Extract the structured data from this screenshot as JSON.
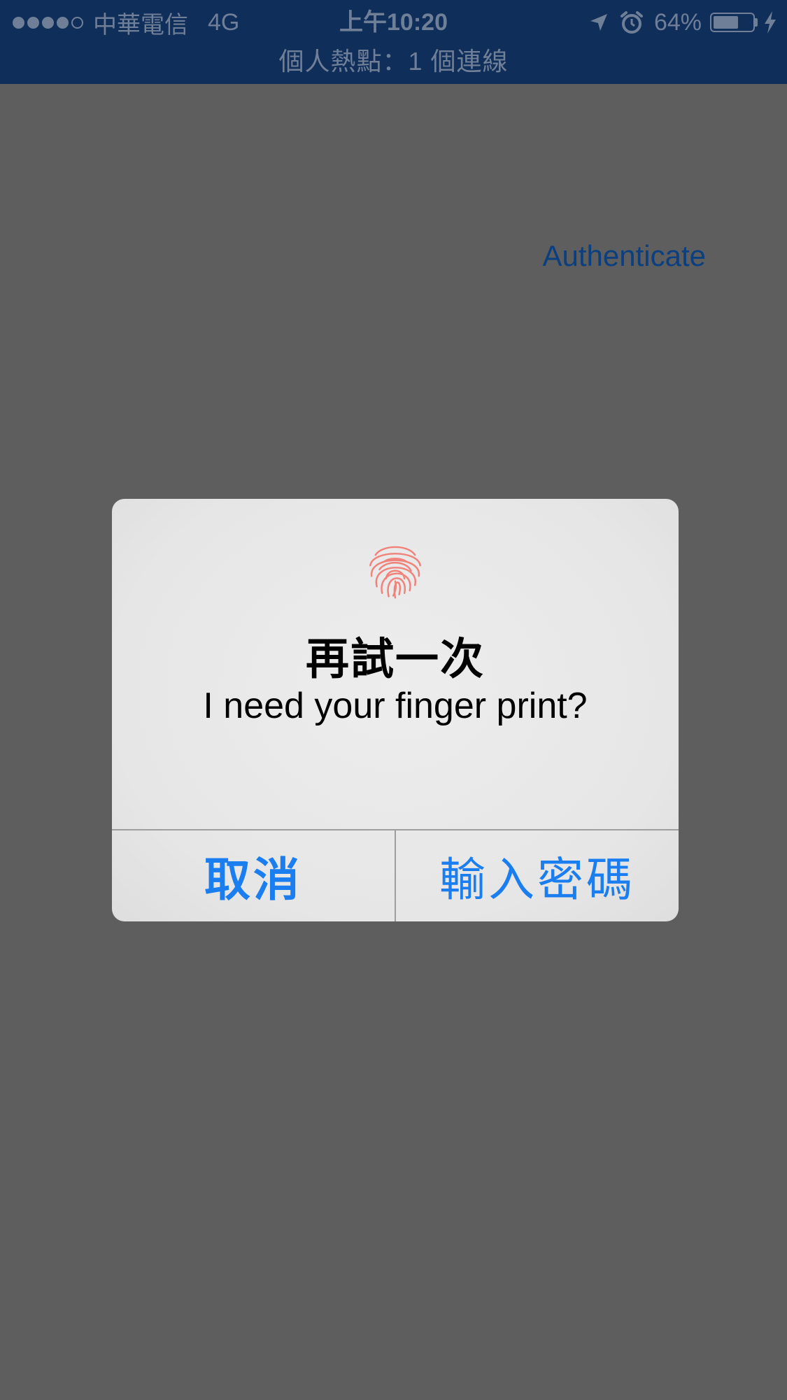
{
  "status_bar": {
    "signal_dots_filled": 4,
    "signal_dots_total": 5,
    "carrier": "中華電信",
    "network": "4G",
    "time": "上午10:20",
    "battery_percent": "64%",
    "battery_level": 0.64,
    "hotspot_text": "個人熱點：1 個連線",
    "icons": [
      "location-arrow-icon",
      "alarm-icon",
      "battery-icon",
      "charging-bolt-icon"
    ]
  },
  "app": {
    "authenticate_label": "Authenticate"
  },
  "alert": {
    "icon": "fingerprint-icon",
    "title": "再試一次",
    "message": "I need your finger print?",
    "cancel_label": "取消",
    "password_label": "輸入密碼"
  },
  "colors": {
    "status_bar_bg": "#0f2e5a",
    "dimmed_bg": "#5e5e5e",
    "alert_button": "#1a7ef0",
    "fingerprint": "#f0827a",
    "authenticate": "#0b3f7f"
  }
}
